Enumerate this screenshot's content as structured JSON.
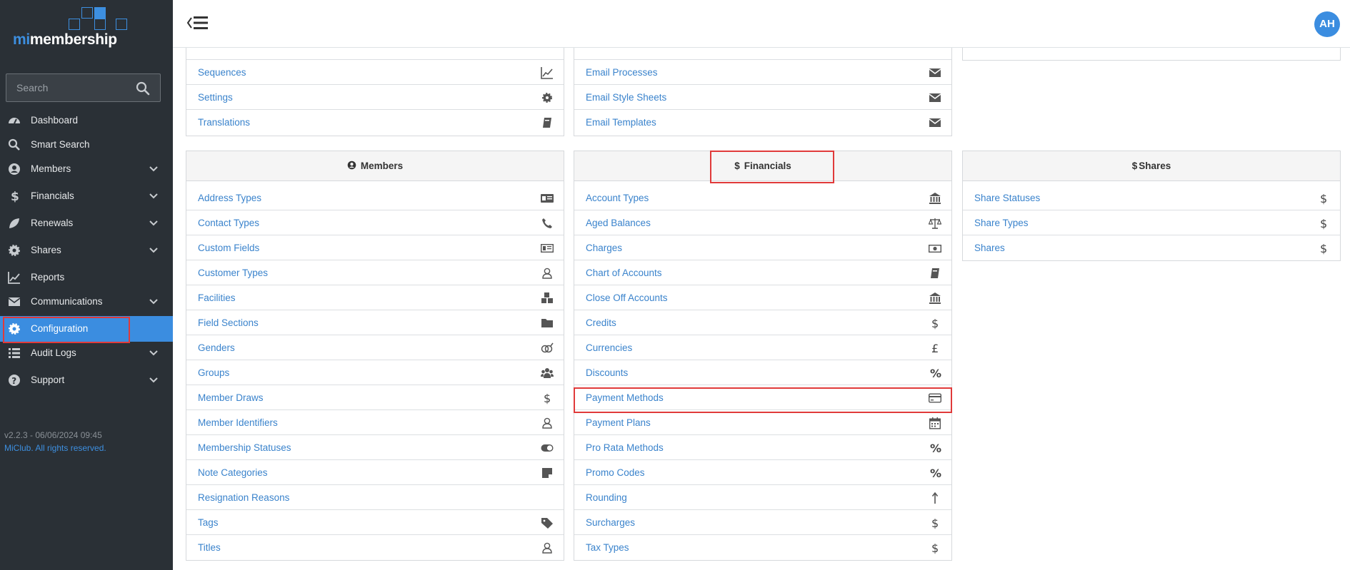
{
  "brand": {
    "logo_prefix": "mi",
    "logo_suffix": "membership"
  },
  "search": {
    "placeholder": "Search"
  },
  "nav": {
    "items": [
      {
        "label": "Dashboard",
        "icon": "dashboard-icon"
      },
      {
        "label": "Smart Search",
        "icon": "search-icon"
      },
      {
        "label": "Members",
        "icon": "user-circle-icon"
      },
      {
        "label": "Financials",
        "icon": "dollar-icon"
      },
      {
        "label": "Renewals",
        "icon": "leaf-icon"
      },
      {
        "label": "Shares",
        "icon": "gear-icon"
      },
      {
        "label": "Reports",
        "icon": "line-chart-icon"
      },
      {
        "label": "Communications",
        "icon": "envelope-icon"
      },
      {
        "label": "Configuration",
        "icon": "cog-icon"
      },
      {
        "label": "Audit Logs",
        "icon": "list-icon"
      },
      {
        "label": "Support",
        "icon": "question-icon"
      }
    ]
  },
  "footer": {
    "version": "v2.2.3 - 06/06/2024 09:45",
    "copyright": "MiClub. All rights reserved."
  },
  "user": {
    "initials": "AH"
  },
  "top_panels": {
    "left": [
      "Sequences",
      "Settings",
      "Translations"
    ],
    "middle": [
      "Email Processes",
      "Email Style Sheets",
      "Email Templates"
    ]
  },
  "panels": {
    "members": {
      "title": "Members",
      "rows": [
        "Address Types",
        "Contact Types",
        "Custom Fields",
        "Customer Types",
        "Facilities",
        "Field Sections",
        "Genders",
        "Groups",
        "Member Draws",
        "Member Identifiers",
        "Membership Statuses",
        "Note Categories",
        "Resignation Reasons",
        "Tags",
        "Titles"
      ]
    },
    "financials": {
      "title": "Financials",
      "rows": [
        "Account Types",
        "Aged Balances",
        "Charges",
        "Chart of Accounts",
        "Close Off Accounts",
        "Credits",
        "Currencies",
        "Discounts",
        "Payment Methods",
        "Payment Plans",
        "Pro Rata Methods",
        "Promo Codes",
        "Rounding",
        "Surcharges",
        "Tax Types"
      ]
    },
    "shares": {
      "title": "Shares",
      "rows": [
        "Share Statuses",
        "Share Types",
        "Shares"
      ]
    }
  },
  "colors": {
    "sidebar": "#2a3036",
    "accent": "#3b8de0",
    "link": "#3a83cc",
    "highlight": "#e03a3a"
  }
}
